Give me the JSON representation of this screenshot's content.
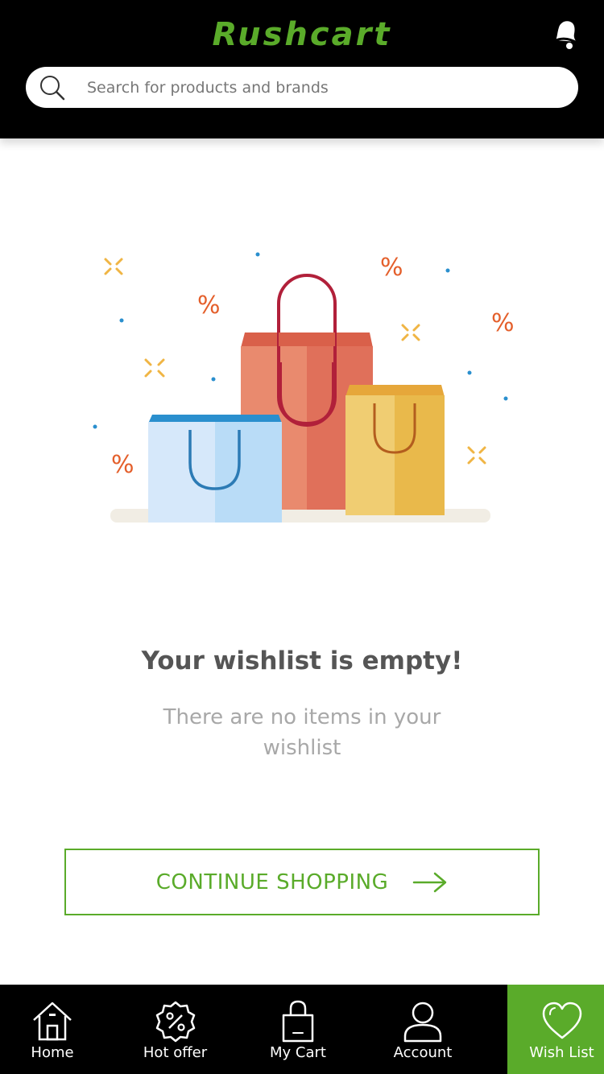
{
  "colors": {
    "brand": "#5aab2a",
    "header_bg": "#000000",
    "nav_bg": "#000000"
  },
  "header": {
    "app_title": "Rushcart",
    "bell_icon": "bell-icon"
  },
  "search": {
    "placeholder": "Search for products and brands",
    "icon": "search-icon"
  },
  "empty_state": {
    "illustration": "shopping-bags-illustration",
    "title": "Your wishlist is empty!",
    "subtitle": "There are no items in your wishlist"
  },
  "cta": {
    "label": "CONTINUE SHOPPING",
    "icon": "arrow-right-icon"
  },
  "bottom_nav": {
    "items": [
      {
        "label": "Home",
        "icon": "home-icon",
        "active": false
      },
      {
        "label": "Hot offer",
        "icon": "discount-badge-icon",
        "active": false
      },
      {
        "label": "My Cart",
        "icon": "shopping-bag-icon",
        "active": false
      },
      {
        "label": "Account",
        "icon": "user-icon",
        "active": false
      },
      {
        "label": "Wish List",
        "icon": "heart-icon",
        "active": true
      }
    ]
  }
}
